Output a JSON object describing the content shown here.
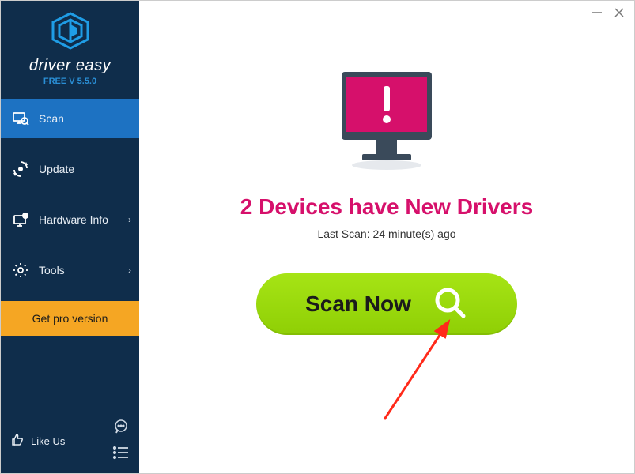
{
  "brand": {
    "name": "driver easy",
    "version": "FREE V 5.5.0"
  },
  "nav": {
    "scan": "Scan",
    "update": "Update",
    "hardware": "Hardware Info",
    "tools": "Tools"
  },
  "pro_button": "Get pro version",
  "like_us": "Like Us",
  "main": {
    "headline": "2 Devices have New Drivers",
    "last_scan": "Last Scan: 24 minute(s) ago",
    "scan_button": "Scan Now"
  },
  "colors": {
    "sidebar": "#0f2d4b",
    "active": "#1d72c2",
    "accent_blue": "#2a8fd6",
    "pro_orange": "#f5a623",
    "alert_pink": "#d6106b",
    "scan_green": "#9ad80a"
  }
}
